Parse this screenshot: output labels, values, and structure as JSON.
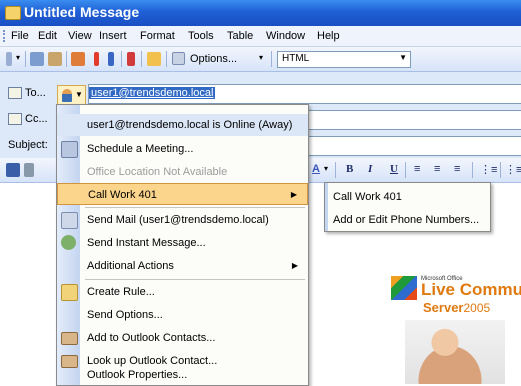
{
  "window": {
    "title": "Untitled Message"
  },
  "menubar": [
    "File",
    "Edit",
    "View",
    "Insert",
    "Format",
    "Tools",
    "Table",
    "Window",
    "Help"
  ],
  "toolbar": {
    "options_label": "Options...",
    "format_value": "HTML"
  },
  "header": {
    "to_label": "To...",
    "cc_label": "Cc...",
    "subject_label": "Subject:",
    "to_value": "user1@trendsdemo.local"
  },
  "formatting": {
    "b": "B",
    "i": "I",
    "u": "U",
    "a": "A"
  },
  "context_menu": {
    "status": "user1@trendsdemo.local is Online (Away)",
    "schedule": "Schedule a Meeting...",
    "office_location": "Office Location Not Available",
    "call_work": "Call Work 401",
    "send_mail": "Send Mail (user1@trendsdemo.local)",
    "send_im": "Send Instant Message...",
    "additional": "Additional Actions",
    "create_rule": "Create Rule...",
    "send_options": "Send Options...",
    "add_contacts": "Add to Outlook Contacts...",
    "lookup_contact": "Look up Outlook Contact...",
    "properties": "Outlook Properties..."
  },
  "submenu": {
    "call_work": "Call Work 401",
    "add_edit_phone": "Add or Edit Phone Numbers..."
  },
  "ad": {
    "ms_label": "Microsoft Office",
    "live": "Live Commu",
    "server": "Server",
    "year": "2005"
  },
  "colors": {
    "title_bar": "#1f5fd6",
    "highlight": "#fcd58c",
    "selection": "#316ac5"
  }
}
